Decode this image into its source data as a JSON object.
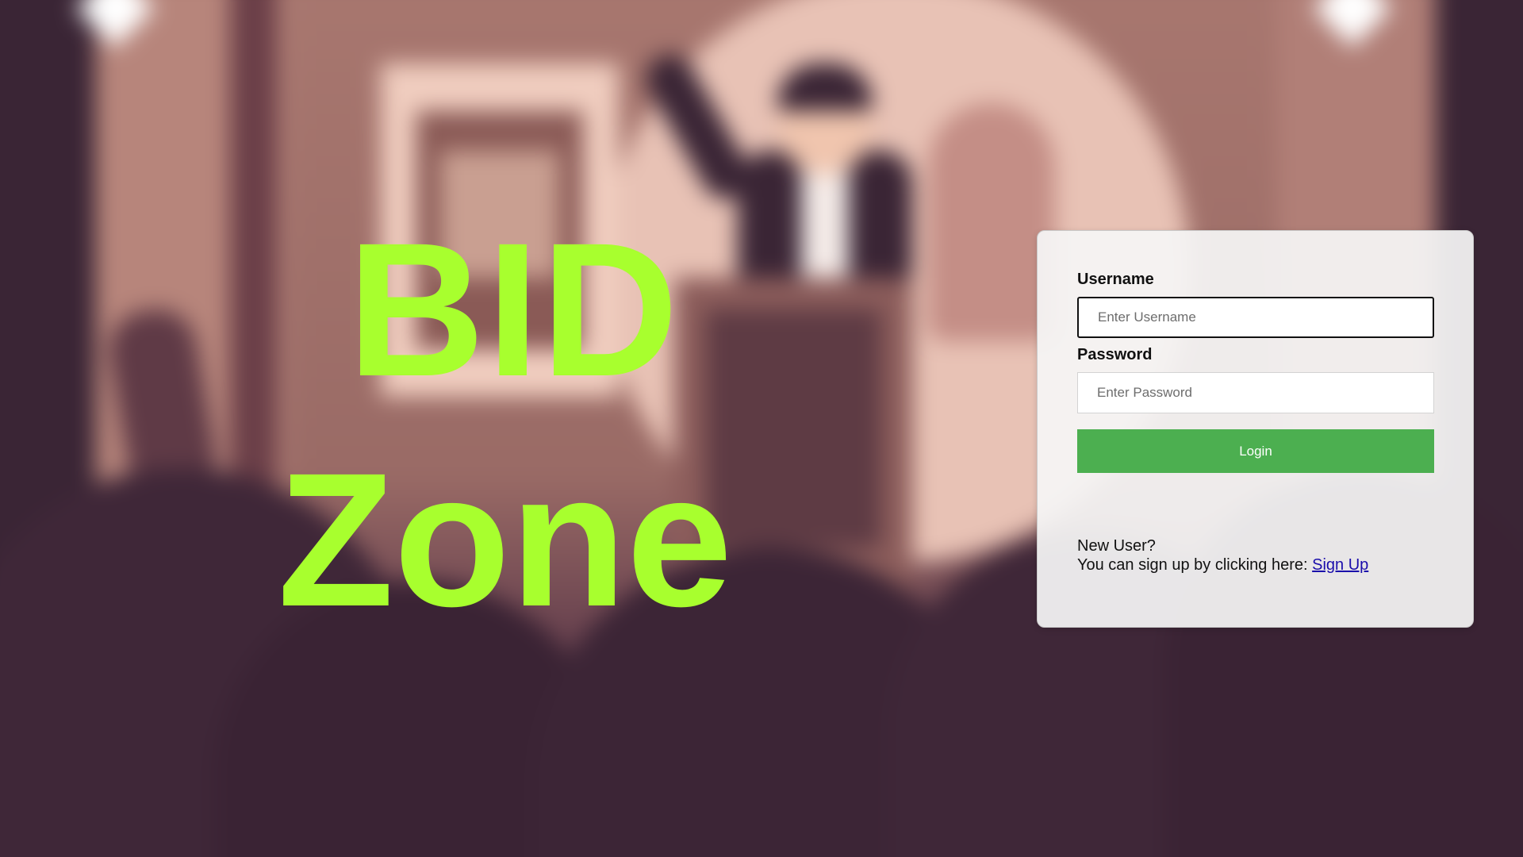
{
  "brand": {
    "line1": "BID",
    "line2": "Zone",
    "color": "#a8ff2e"
  },
  "login": {
    "username_label": "Username",
    "username_placeholder": "Enter Username",
    "username_value": "",
    "password_label": "Password",
    "password_placeholder": "Enter Password",
    "password_value": "",
    "login_button": "Login",
    "login_button_color": "#4caf50",
    "new_user_text": "New User?",
    "signup_prompt": "You can sign up by clicking here:",
    "signup_link": "Sign Up"
  }
}
